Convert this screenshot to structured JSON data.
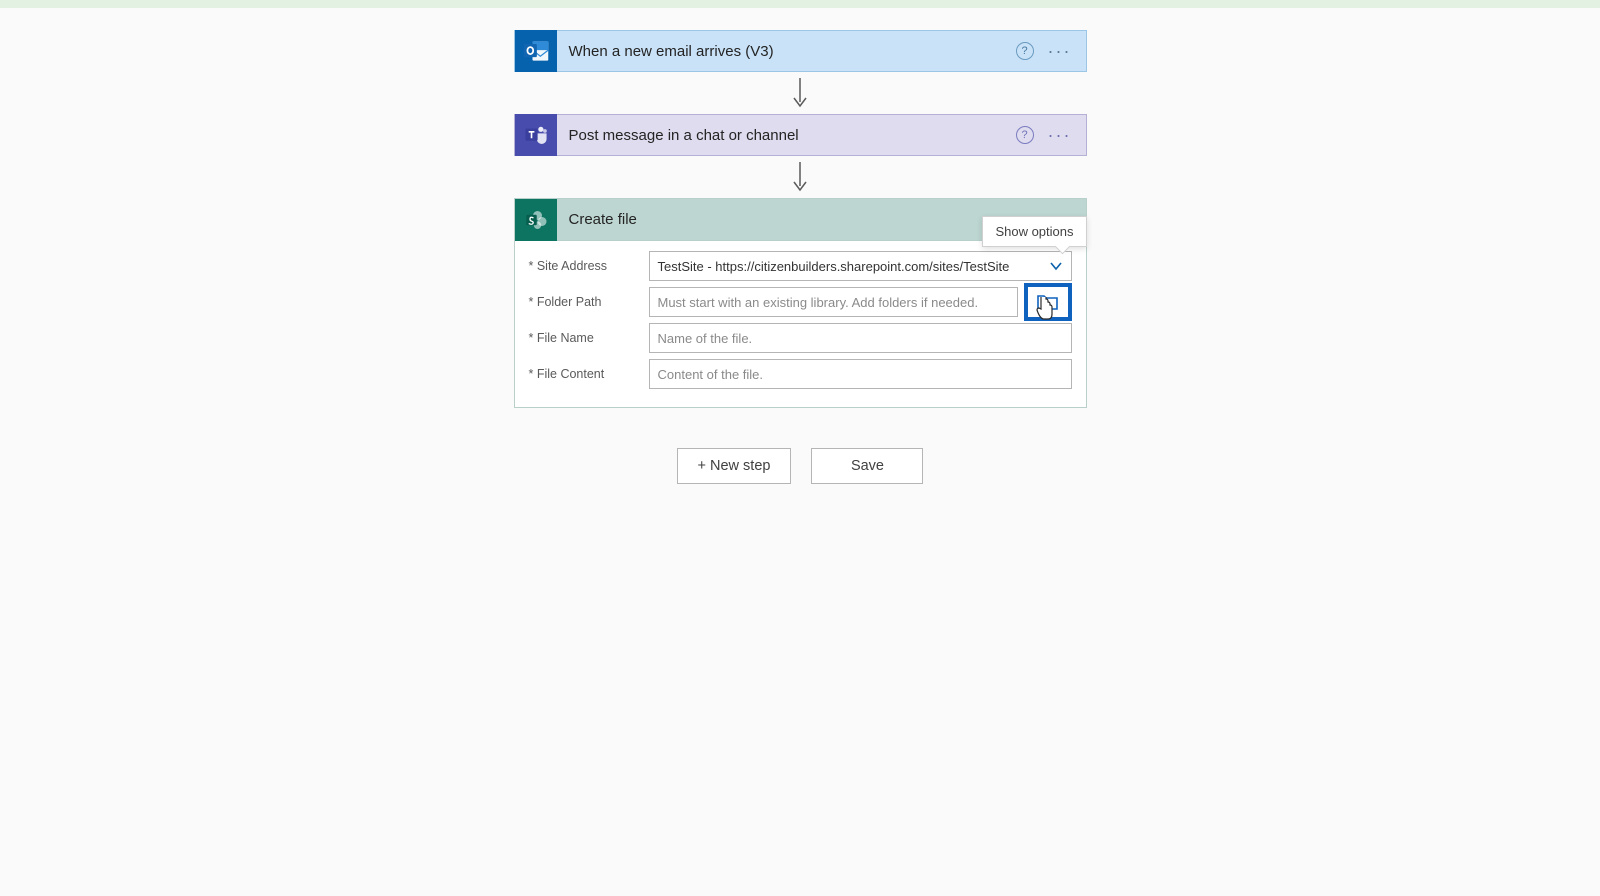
{
  "trigger": {
    "title": "When a new email arrives (V3)"
  },
  "action1": {
    "title": "Post message in a chat or channel"
  },
  "action2": {
    "title": "Create file",
    "show_options_label": "Show options",
    "fields": {
      "site_address": {
        "label": "* Site Address",
        "value": "TestSite - https://citizenbuilders.sharepoint.com/sites/TestSite"
      },
      "folder_path": {
        "label": "* Folder Path",
        "placeholder": "Must start with an existing library. Add folders if needed."
      },
      "file_name": {
        "label": "* File Name",
        "placeholder": "Name of the file."
      },
      "file_content": {
        "label": "* File Content",
        "placeholder": "Content of the file."
      }
    }
  },
  "footer": {
    "new_step": "+ New step",
    "save": "Save"
  }
}
